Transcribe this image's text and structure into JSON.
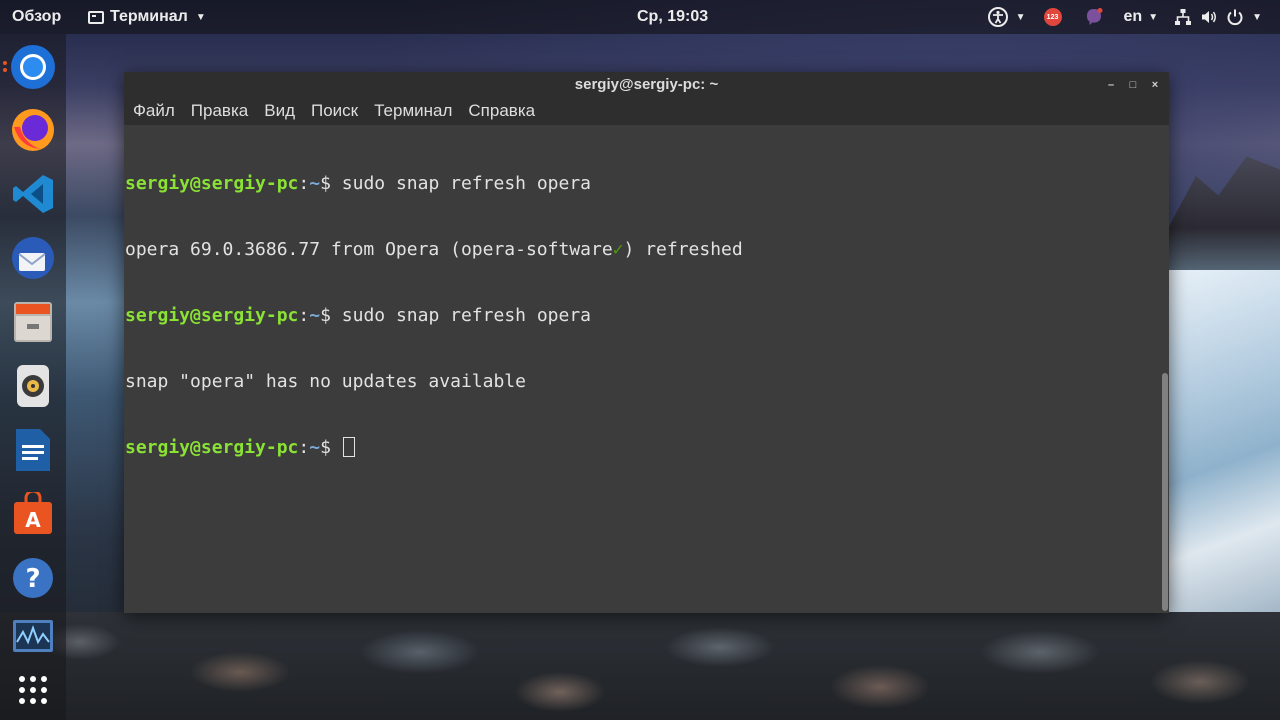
{
  "topbar": {
    "activities": "Обзор",
    "app_menu": "Терминал",
    "clock": "Ср, 19:03",
    "badge_count": "123",
    "language": "en"
  },
  "dock": {
    "items": [
      "chromium-icon",
      "firefox-icon",
      "vscode-icon",
      "thunderbird-icon",
      "files-icon",
      "rhythmbox-icon",
      "writer-icon",
      "software-center-icon",
      "help-icon",
      "system-monitor-icon",
      "app-grid-icon"
    ]
  },
  "window": {
    "title": "sergiy@sergiy-pc: ~",
    "controls": {
      "minimize": "–",
      "maximize": "□",
      "close": "×"
    },
    "menu": [
      "Файл",
      "Правка",
      "Вид",
      "Поиск",
      "Терминал",
      "Справка"
    ]
  },
  "terminal": {
    "user_host": "sergiy@sergiy-pc",
    "colon": ":",
    "path": "~",
    "dollar": "$ ",
    "lines": [
      {
        "cmd": "sudo snap refresh opera"
      },
      {
        "out_a": "opera 69.0.3686.77 from Opera (opera-software",
        "check": "✓",
        "out_b": ") refreshed"
      },
      {
        "cmd": "sudo snap refresh opera"
      },
      {
        "out": "snap \"opera\" has no updates available"
      },
      {
        "cmd": ""
      }
    ]
  },
  "colors": {
    "prompt_user": "#8ae234",
    "prompt_path": "#7ba7d4",
    "accent": "#e95420",
    "terminal_bg": "#3c3c3c"
  }
}
